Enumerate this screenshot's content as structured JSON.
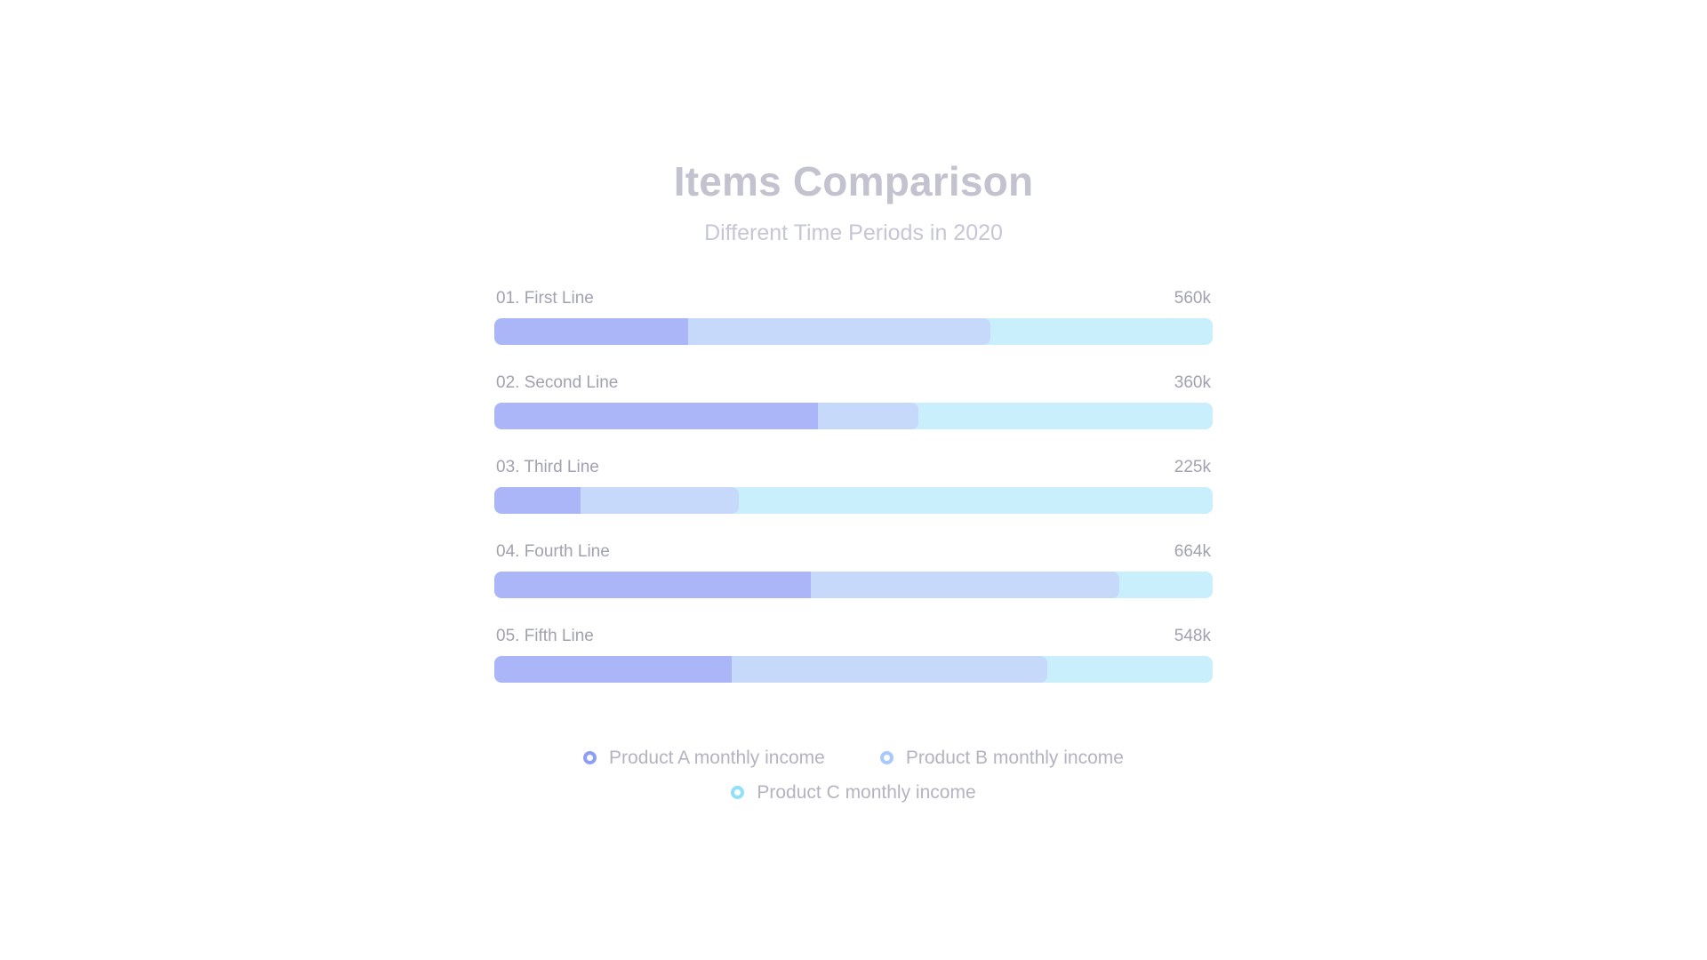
{
  "header": {
    "title": "Items Comparison",
    "subtitle": "Different Time Periods in 2020"
  },
  "legend": {
    "items": [
      {
        "label": "Product A monthly income",
        "color": "#8e9ef5",
        "marker": "ring-icon"
      },
      {
        "label": "Product B monthly income",
        "color": "#a9c8fb",
        "marker": "ring-icon"
      },
      {
        "label": "Product C monthly income",
        "color": "#8fe0f8",
        "marker": "ring-icon"
      }
    ]
  },
  "colors": {
    "series_a": "#aab6f7",
    "series_b": "#c7d9fb",
    "series_c": "#c9effc",
    "title": "#c2c3ce",
    "subtitle": "#c6c7d4",
    "label": "#a1a2af"
  },
  "chart_data": {
    "type": "bar",
    "orientation": "horizontal",
    "stacked": true,
    "title": "Items Comparison",
    "subtitle": "Different Time Periods in 2020",
    "xlabel": "",
    "ylabel": "",
    "grid": false,
    "legend_position": "bottom",
    "categories": [
      "01. First Line",
      "02. Second Line",
      "03. Third Line",
      "04. Fourth Line",
      "05. Fifth Line"
    ],
    "totals": [
      "560k",
      "360k",
      "225k",
      "664k",
      "548k"
    ],
    "totals_numeric": [
      560000,
      360000,
      225000,
      664000,
      548000
    ],
    "series": [
      {
        "name": "Product A monthly income",
        "color": "#aab6f7",
        "percent_of_bar": [
          27,
          45,
          12,
          44,
          33
        ]
      },
      {
        "name": "Product B monthly income",
        "color": "#c7d9fb",
        "percent_of_bar": [
          43,
          15,
          23,
          44,
          45
        ]
      },
      {
        "name": "Product C monthly income",
        "color": "#c9effc",
        "percent_of_bar": [
          30,
          40,
          65,
          12,
          22
        ]
      }
    ],
    "rows": [
      {
        "label": "01. First Line",
        "total": "560k",
        "segments": [
          27,
          43,
          30
        ]
      },
      {
        "label": "02. Second Line",
        "total": "360k",
        "segments": [
          45,
          15,
          40
        ]
      },
      {
        "label": "03. Third Line",
        "total": "225k",
        "segments": [
          12,
          23,
          65
        ]
      },
      {
        "label": "04. Fourth Line",
        "total": "664k",
        "segments": [
          44,
          44,
          12
        ]
      },
      {
        "label": "05. Fifth Line",
        "total": "548k",
        "segments": [
          33,
          45,
          22
        ]
      }
    ]
  }
}
